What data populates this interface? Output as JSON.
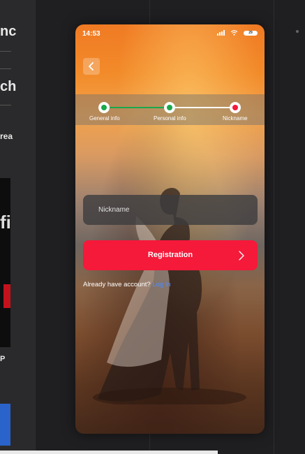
{
  "background_page": {
    "fragments": [
      "nc",
      "ch",
      "rea",
      "fi",
      "P"
    ],
    "accent_red": "#c4121c",
    "accent_blue": "#2a63c9"
  },
  "status_bar": {
    "time": "14:53",
    "battery": "29"
  },
  "icons": {
    "back": "chevron-left-icon",
    "signal": "signal-icon",
    "wifi": "wifi-icon",
    "battery": "battery-icon",
    "next": "chevron-right-icon"
  },
  "stepper": {
    "steps": [
      {
        "label": "General info",
        "state": "done",
        "color": "#1aa84b"
      },
      {
        "label": "Personal info",
        "state": "done",
        "color": "#1aa84b"
      },
      {
        "label": "Nickname",
        "state": "current",
        "color": "#f5193a"
      }
    ]
  },
  "form": {
    "nickname_placeholder": "Nickname",
    "nickname_value": "",
    "register_label": "Registration"
  },
  "footer": {
    "already_text": "Already have account?",
    "login_link": "Log In"
  },
  "colors": {
    "primary": "#f5193a",
    "success": "#1aa84b",
    "link": "#4e8cff"
  }
}
